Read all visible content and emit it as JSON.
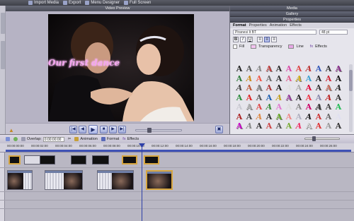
{
  "toolbar": {
    "import_media": "Import Media",
    "export": "Export",
    "menu_designer": "Menu Designer",
    "full_screen": "Full Screen"
  },
  "preview": {
    "header": "Video Preview",
    "caption": "Our first dance"
  },
  "right_panel": {
    "media_header": "Media",
    "gallery_header": "Gallery",
    "properties_header": "Properties",
    "tabs": [
      "Format",
      "Properties",
      "Animation",
      "Effects"
    ],
    "font_name": "Piranesi It BT",
    "font_size": "48 pt",
    "bold": "B",
    "italic": "I",
    "underline": "U",
    "fill_label": "Fill",
    "transparency_label": "Transparency",
    "line_label": "Line",
    "effects_label": "Effects"
  },
  "timeline_toolbar": {
    "overlap_label": "Overlap:",
    "overlap_value": "0:00:00:00",
    "animation_label": "Animation",
    "format_label": "Format",
    "effects_label": "Effects"
  },
  "ruler": {
    "ticks": [
      "00:00:00:00",
      "00:00:02:00",
      "00:00:04:00",
      "00:00:06:00",
      "00:00:08:00",
      "00:00:10:00",
      "00:00:12:00",
      "00:00:14:00",
      "00:00:16:00",
      "00:00:18:00",
      "00:00:20:00",
      "00:00:22:00",
      "00:00:24:00",
      "00:00:26:00"
    ]
  },
  "colors": {
    "caption": "#f4a3ef",
    "accent": "#3f52b5",
    "selection": "#d7a640"
  }
}
